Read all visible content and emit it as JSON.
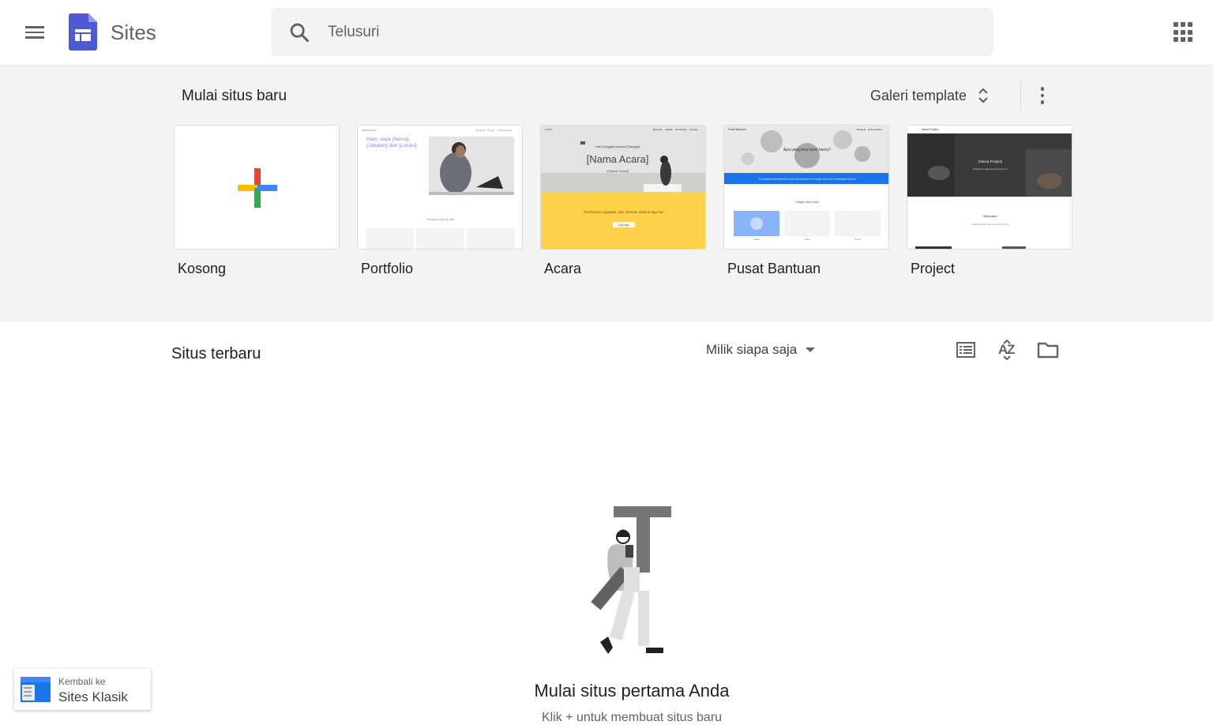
{
  "header": {
    "app_name": "Sites",
    "search_placeholder": "Telusuri"
  },
  "templates": {
    "section_title": "Mulai situs baru",
    "gallery_label": "Galeri template",
    "cards": [
      {
        "label": "Kosong"
      },
      {
        "label": "Portfolio"
      },
      {
        "label": "Acara"
      },
      {
        "label": "Pusat Bantuan"
      },
      {
        "label": "Project"
      }
    ],
    "previews": {
      "portfolio": {
        "site_name": "Nama Anda",
        "nav": [
          "Beranda",
          "Proyek",
          "Hubungi saya"
        ],
        "hero_text": "Halo, saya [Nama], [Jabatan] dari [Lokasi].",
        "caption": "Pelajari saya di sini"
      },
      "acara": {
        "site_name": "Acara",
        "nav": [
          "Beranda",
          "Jadwal",
          "Pembicara",
          "Tempat"
        ],
        "subtitle": "Hari [Tanggal] sampai [Tanggal]",
        "title": "[Nama Acara]",
        "venue": "di [Nama Tempat]",
        "band_text": "Konferensi, kegiatan, dan seminar selama tiga hari",
        "button": "DAFTAR"
      },
      "pusat_bantuan": {
        "site_name": "Pusat Bantuan",
        "nav": [
          "Beranda",
          "Dokumentasi"
        ],
        "question": "Apa yang bisa kami bantu?",
        "band_text": "Cari jawaban atas pertanyaan umum atau hubungi tim dukungan kami untuk mendapatkan bantuan",
        "section": "Pelajari lebih lanjut",
        "tiles": [
          "Artikel",
          "Video",
          "Forum"
        ]
      },
      "project": {
        "site_name": "Nama Project",
        "hero_title": "[Nama Project]",
        "hero_sub": "Deskripsi singkat tentang project ini",
        "section": "Misi project",
        "section_sub": "Jelaskan tujuan dan misi project di sini"
      }
    }
  },
  "recent": {
    "section_title": "Situs terbaru",
    "owner_filter": "Milik siapa saja",
    "empty_title": "Mulai situs pertama Anda",
    "empty_subtitle": "Klik + untuk membuat situs baru"
  },
  "classic": {
    "line1": "Kembali ke",
    "line2": "Sites Klasik"
  },
  "colors": {
    "brand_blue": "#4c5bd4",
    "google_red": "#ea4335",
    "google_yellow": "#fbbc04",
    "google_green": "#34a853",
    "google_blue": "#4285f4",
    "event_yellow": "#fdd24a",
    "help_blue": "#1a73e8",
    "band_gray": "#f1f3f4"
  }
}
